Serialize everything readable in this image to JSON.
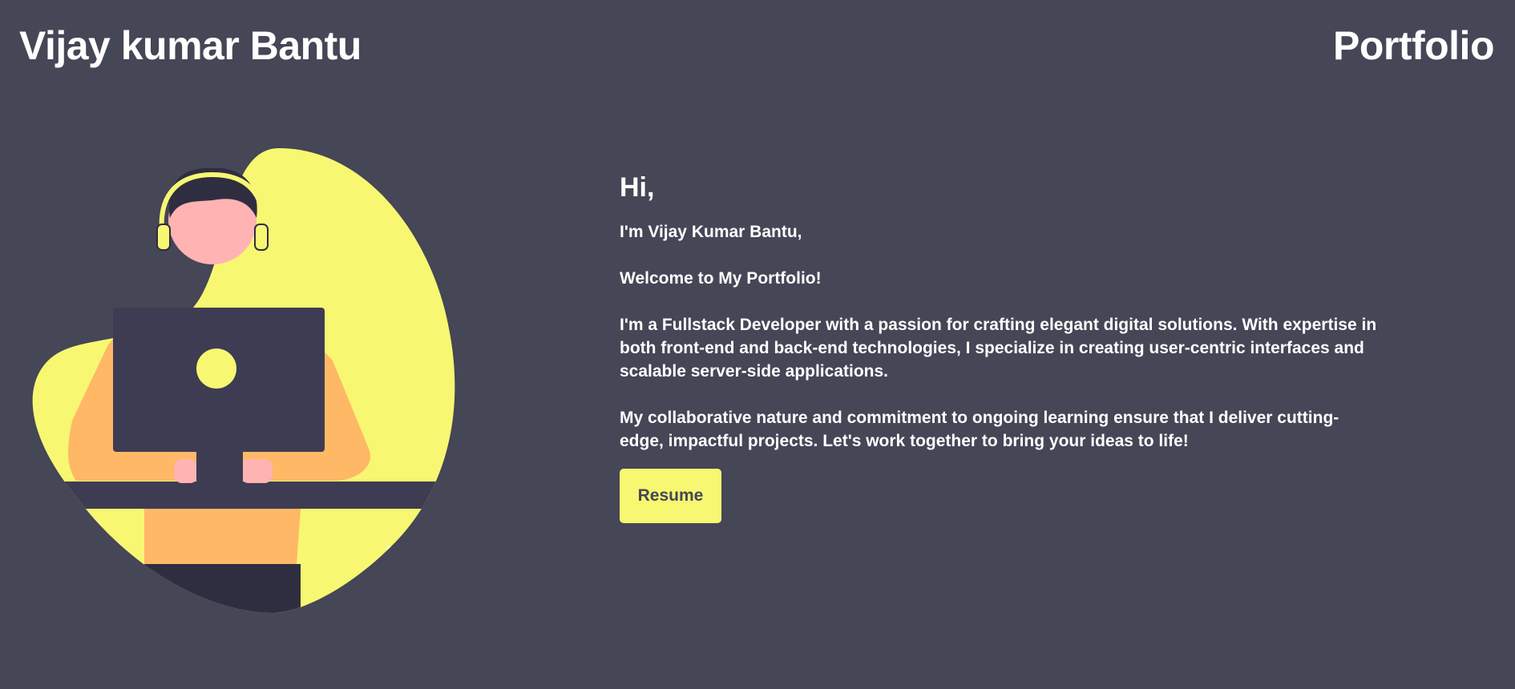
{
  "header": {
    "name": "Vijay kumar Bantu",
    "nav_title": "Portfolio"
  },
  "intro": {
    "greeting": "Hi,",
    "name_line": "I'm Vijay Kumar Bantu,",
    "welcome": "Welcome to My Portfolio!",
    "para1": "I'm a Fullstack Developer with a passion for crafting elegant digital solutions. With expertise in both front-end and back-end technologies, I specialize in creating user-centric interfaces and scalable server-side applications.",
    "para2": "My collaborative nature and commitment to ongoing learning ensure that I deliver cutting-edge, impactful projects. Let's work together to bring your ideas to life!",
    "resume_label": "Resume"
  },
  "illustration": {
    "name": "developer-at-laptop-illustration"
  },
  "colors": {
    "background": "#454656",
    "accent": "#f8f772",
    "text": "#ffffff",
    "shirt": "#ffb866",
    "skin": "#ffb3b3",
    "laptop": "#3e3c52"
  }
}
